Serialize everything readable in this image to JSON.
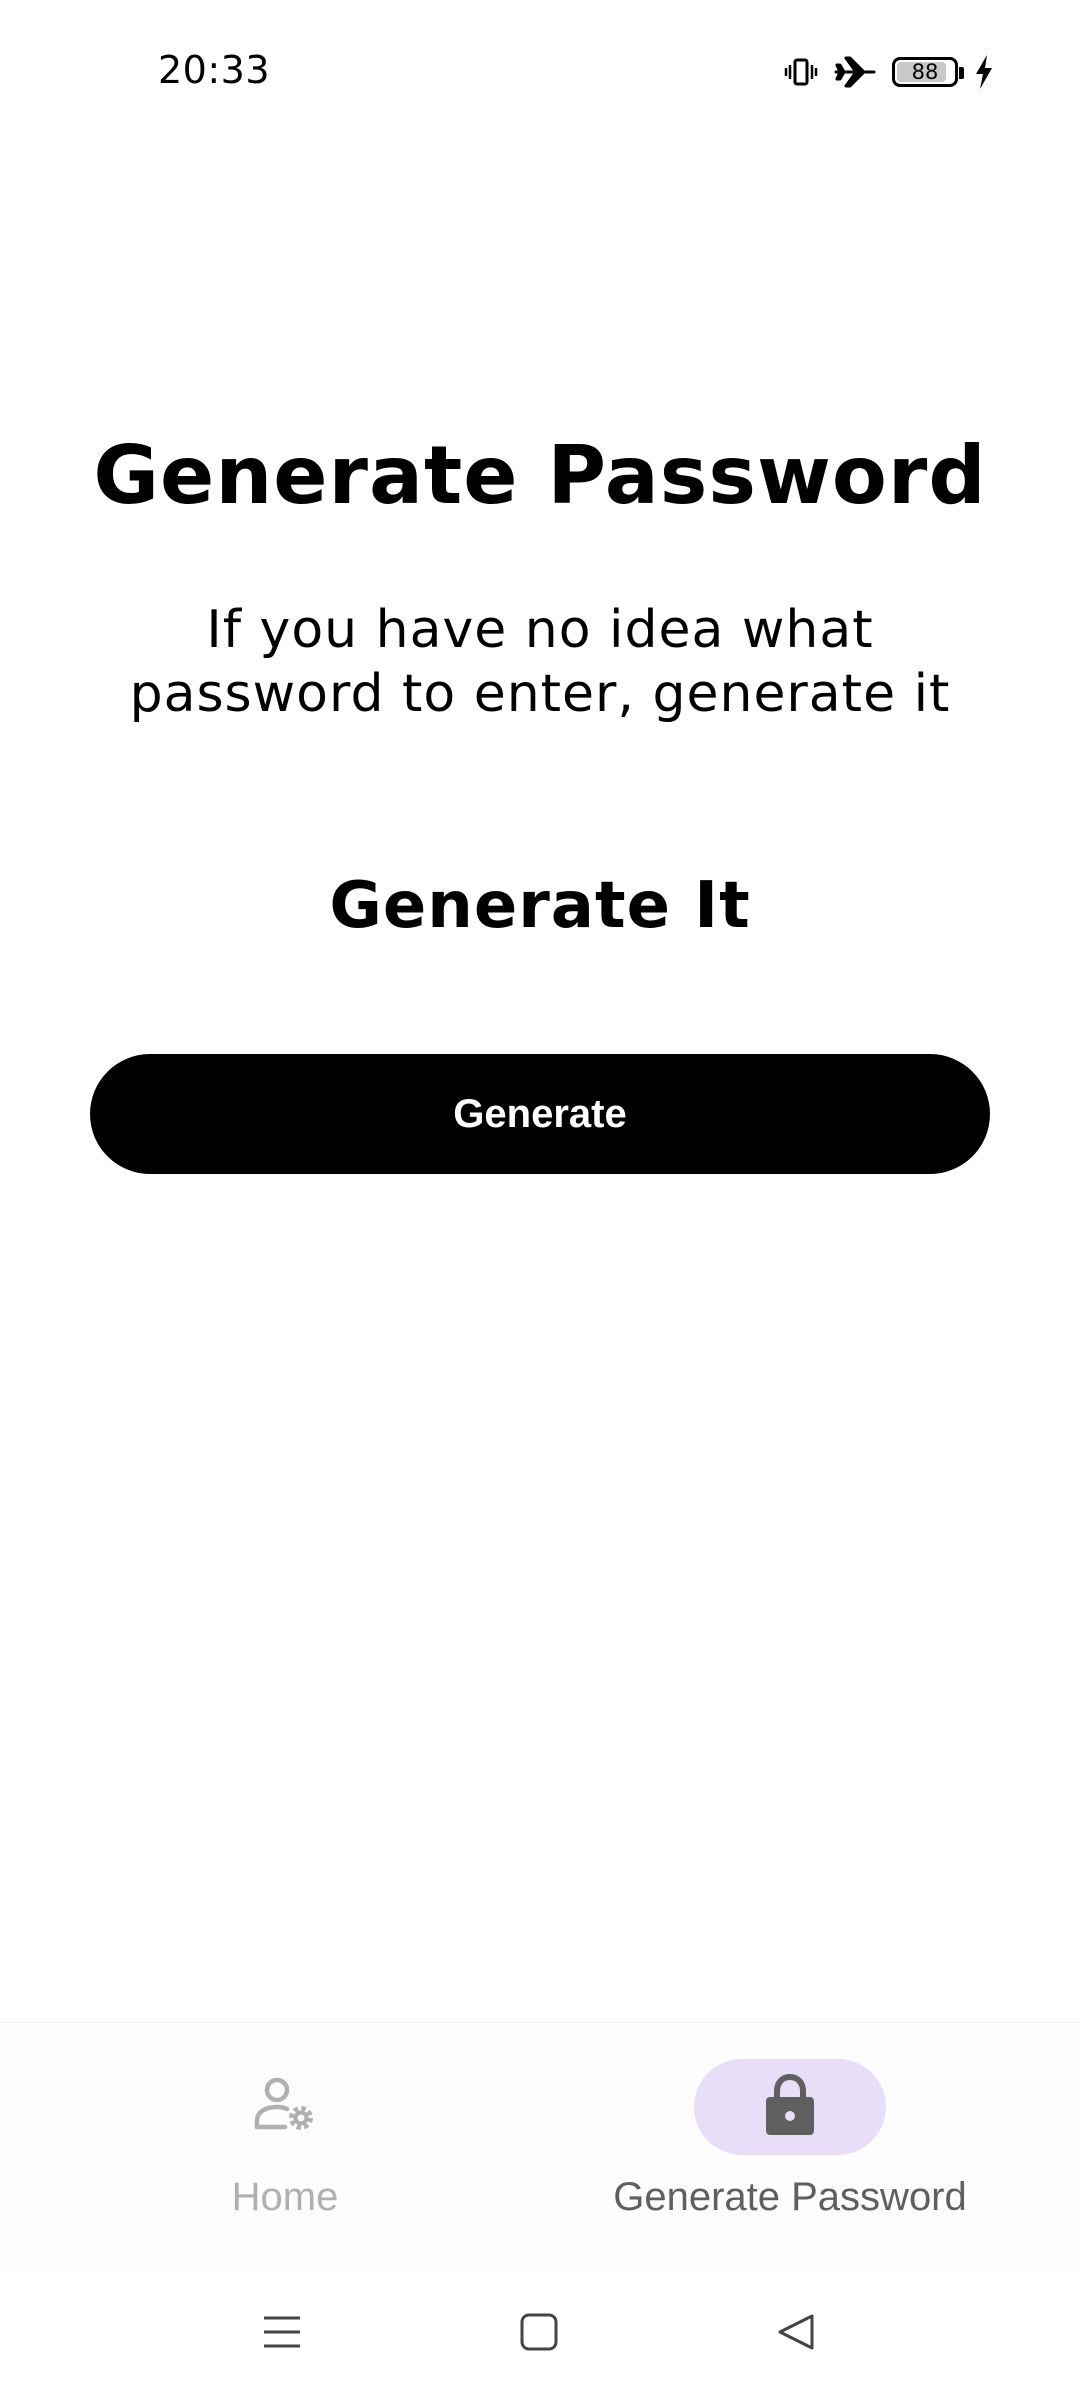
{
  "status_bar": {
    "time": "20:33",
    "battery_level": "88",
    "battery_fraction": 0.88,
    "icons": [
      "vibrate-icon",
      "airplane-mode-icon",
      "battery-icon",
      "charging-icon"
    ]
  },
  "main": {
    "title": "Generate Password",
    "subtitle": "If you have no idea what password to enter, generate it",
    "section_heading": "Generate It",
    "generate_button_label": "Generate"
  },
  "bottom_nav": {
    "items": [
      {
        "label": "Home",
        "icon": "user-settings-icon",
        "selected": false
      },
      {
        "label": "Generate Password",
        "icon": "lock-icon",
        "selected": true
      }
    ]
  },
  "system_nav": {
    "icons": [
      "menu-icon",
      "home-square-icon",
      "back-triangle-icon"
    ]
  },
  "colors": {
    "background": "#ffffff",
    "button_bg": "#000000",
    "button_text": "#ffffff",
    "nav_selected_pill": "#e8def8",
    "nav_selected_text": "#5f5f5f",
    "nav_unselected_text": "#b0b0b0"
  }
}
